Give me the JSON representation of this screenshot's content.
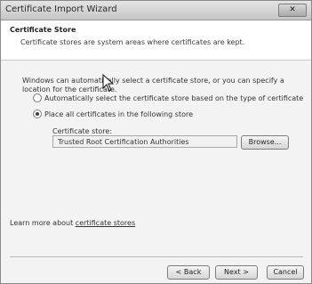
{
  "window": {
    "title": "Certificate Import Wizard",
    "close_label": "✕"
  },
  "header": {
    "title": "Certificate Store",
    "description": "Certificate stores are system areas where certificates are kept."
  },
  "main": {
    "intro": "Windows can automatically select a certificate store, or you can specify a location for the certificate.",
    "options": [
      {
        "label": "Automatically select the certificate store based on the type of certificate",
        "selected": false
      },
      {
        "label": "Place all certificates in the following store",
        "selected": true
      }
    ],
    "store_label": "Certificate store:",
    "store_value": "Trusted Root Certification Authorities",
    "browse_label": "Browse...",
    "learn_more_prefix": "Learn more about ",
    "learn_more_link": "certificate stores"
  },
  "footer": {
    "back_label": "< Back",
    "next_label": "Next >",
    "cancel_label": "Cancel"
  }
}
